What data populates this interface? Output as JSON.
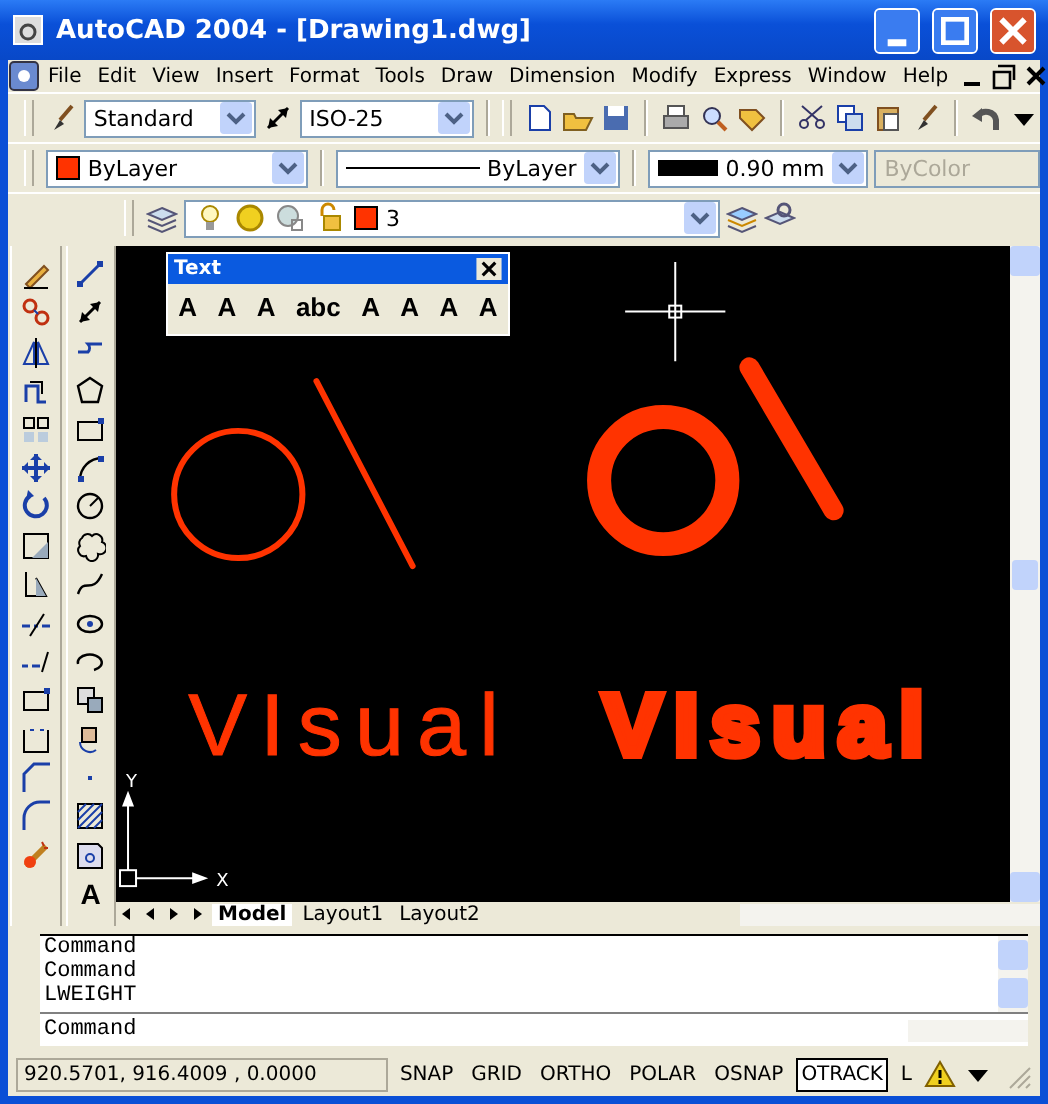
{
  "window": {
    "title": "AutoCAD 2004 - [Drawing1.dwg]"
  },
  "menu": [
    "File",
    "Edit",
    "View",
    "Insert",
    "Format",
    "Tools",
    "Draw",
    "Dimension",
    "Modify",
    "Express",
    "Window",
    "Help"
  ],
  "styles_toolbar": {
    "text_style": "Standard",
    "dim_style": "ISO-25"
  },
  "properties_toolbar": {
    "color": {
      "value": "ByLayer",
      "color": "#ff3300"
    },
    "linetype": "ByLayer",
    "lineweight": "0.90 mm",
    "plot_style": {
      "value": "ByColor",
      "disabled": true
    }
  },
  "layers_toolbar": {
    "layer": "3",
    "color": "#ff3300"
  },
  "draw_toolbar": {
    "mtext_glyph": "A"
  },
  "text_toolbar": {
    "title": "Text",
    "buttons": [
      "A",
      "A",
      "A",
      "abc",
      "A",
      "A",
      "A",
      "A"
    ]
  },
  "drawing": {
    "groups": [
      {
        "kind": "thin",
        "text": "VIsual"
      },
      {
        "kind": "bold",
        "text": "VIsual"
      }
    ],
    "ucs": {
      "x_label": "X",
      "y_label": "Y"
    }
  },
  "layout_tabs": [
    {
      "label": "Model",
      "selected": true
    },
    {
      "label": "Layout1",
      "selected": false
    },
    {
      "label": "Layout2",
      "selected": false
    }
  ],
  "command": {
    "history": [
      "Command",
      "Command",
      "LWEIGHT"
    ],
    "prompt": "Command"
  },
  "status_bar": {
    "coordinates": "920.5701, 916.4009 , 0.0000",
    "toggles": [
      {
        "label": "SNAP",
        "on": false
      },
      {
        "label": "GRID",
        "on": false
      },
      {
        "label": "ORTHO",
        "on": false
      },
      {
        "label": "POLAR",
        "on": false
      },
      {
        "label": "OSNAP",
        "on": false
      },
      {
        "label": "OTRACK",
        "on": true
      },
      {
        "label": "L",
        "on": false
      }
    ]
  }
}
